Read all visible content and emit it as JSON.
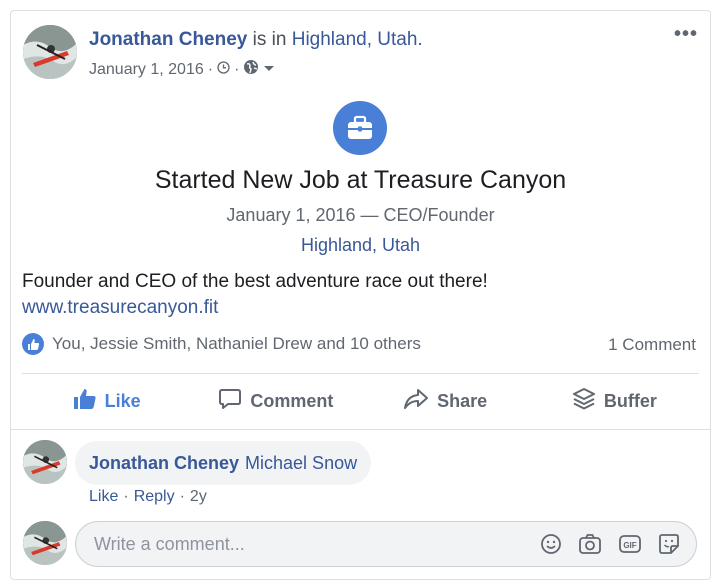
{
  "post": {
    "author": "Jonathan Cheney",
    "is_in": "is in",
    "location": "Highland, Utah.",
    "date": "January 1, 2016",
    "separator": "·",
    "more": "•••"
  },
  "life_event": {
    "icon": "briefcase-icon",
    "title": "Started New Job at Treasure Canyon",
    "subtitle": "January 1, 2016 — CEO/Founder",
    "location": "Highland, Utah"
  },
  "body": {
    "text": "Founder and CEO of the best adventure race out there!",
    "url": "www.treasurecanyon.fit"
  },
  "reactions": {
    "summary": "You, Jessie Smith, Nathaniel Drew and 10 others",
    "comment_count": "1 Comment"
  },
  "actions": [
    {
      "label": "Like",
      "icon": "thumbs-up-icon"
    },
    {
      "label": "Comment",
      "icon": "comment-icon"
    },
    {
      "label": "Share",
      "icon": "share-icon"
    },
    {
      "label": "Buffer",
      "icon": "buffer-icon"
    }
  ],
  "comment": {
    "author": "Jonathan Cheney",
    "tag": "Michael Snow",
    "like": "Like",
    "reply": "Reply",
    "dot": "·",
    "age": "2y"
  },
  "write_comment": {
    "placeholder": "Write a comment...",
    "icons": [
      "emoji-icon",
      "camera-icon",
      "gif-icon",
      "sticker-icon"
    ]
  },
  "colors": {
    "accent": "#4a7fd8",
    "link": "#385898",
    "muted": "#606770",
    "border": "#dddfe2"
  }
}
